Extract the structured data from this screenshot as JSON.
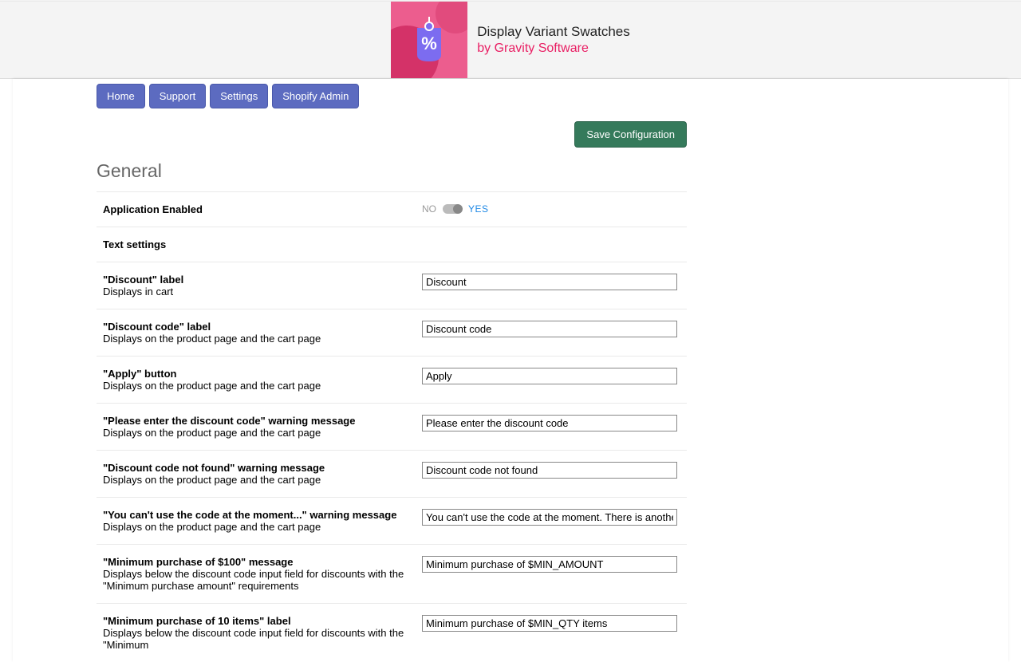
{
  "header": {
    "title": "Display Variant Swatches",
    "byline": "by Gravity Software",
    "logo_glyph": "%"
  },
  "nav": {
    "home": "Home",
    "support": "Support",
    "settings": "Settings",
    "shopify_admin": "Shopify Admin"
  },
  "actions": {
    "save": "Save Configuration"
  },
  "section": {
    "title": "General"
  },
  "app_enabled": {
    "label": "Application Enabled",
    "no": "NO",
    "yes": "YES"
  },
  "text_settings": {
    "heading": "Text settings",
    "discount_label": {
      "title": "\"Discount\" label",
      "help": "Displays in cart",
      "value": "Discount"
    },
    "discount_code_label": {
      "title": "\"Discount code\" label",
      "help": "Displays on the product page and the cart page",
      "value": "Discount code"
    },
    "apply_button": {
      "title": "\"Apply\" button",
      "help": "Displays on the product page and the cart page",
      "value": "Apply"
    },
    "please_enter": {
      "title": "\"Please enter the discount code\" warning message",
      "help": "Displays on the product page and the cart page",
      "value": "Please enter the discount code"
    },
    "not_found": {
      "title": "\"Discount code not found\" warning message",
      "help": "Displays on the product page and the cart page",
      "value": "Discount code not found"
    },
    "cant_use": {
      "title": "\"You can't use the code at the moment...\" warning message",
      "help": "Displays on the product page and the cart page",
      "value": "You can't use the code at the moment. There is another discount applied."
    },
    "min_purchase_amount": {
      "title": "\"Minimum purchase of $100\" message",
      "help": "Displays below the discount code input field for discounts with the \"Minimum purchase amount\" requirements",
      "value": "Minimum purchase of $MIN_AMOUNT"
    },
    "min_purchase_qty": {
      "title": "\"Minimum purchase of 10 items\" label",
      "help": "Displays below the discount code input field for discounts with the \"Minimum",
      "value": "Minimum purchase of $MIN_QTY items"
    }
  }
}
